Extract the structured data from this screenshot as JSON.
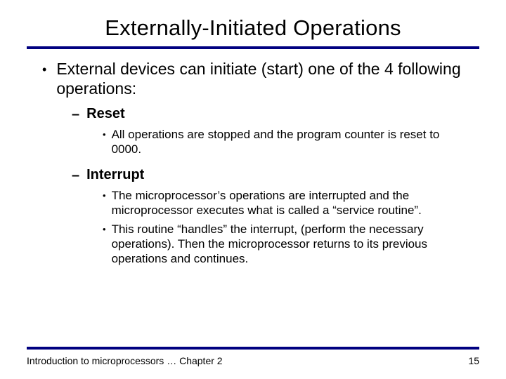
{
  "title": "Externally-Initiated Operations",
  "intro": "External devices can initiate (start) one of the 4 following operations:",
  "items": [
    {
      "label": "Reset",
      "sub": [
        "All operations are stopped and the program counter is reset to 0000."
      ]
    },
    {
      "label": "Interrupt",
      "sub": [
        "The microprocessor’s operations are interrupted and the microprocessor executes what is called a “service routine”.",
        "This routine “handles” the interrupt, (perform the necessary operations). Then the microprocessor returns to its previous operations and continues."
      ]
    }
  ],
  "footer_left": "Introduction to microprocessors … Chapter 2",
  "footer_right": "15"
}
